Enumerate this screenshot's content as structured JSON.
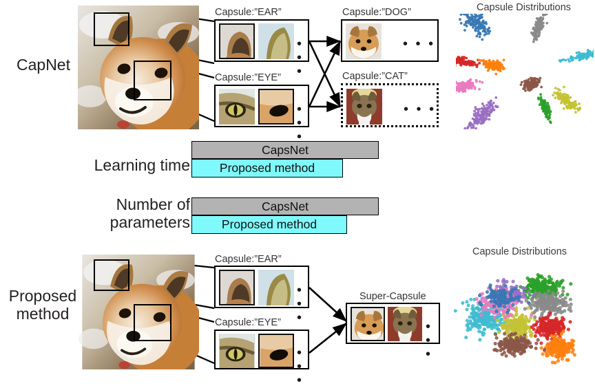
{
  "figure": {
    "rows": [
      {
        "id": "capnet",
        "label": "CapNet"
      },
      {
        "id": "proposed",
        "label": "Proposed\nmethod"
      }
    ]
  },
  "top_row": {
    "row_label": "CapNet",
    "part_capsules": [
      {
        "name": "capsule-ear",
        "label": "Capsule:”EAR”",
        "ellipsis": "• • •",
        "thumbs": [
          "dog-ear-thumb",
          "cat-ear-thumb"
        ]
      },
      {
        "name": "capsule-eye",
        "label": "Capsule:”EYE”",
        "ellipsis": "• • •",
        "thumbs": [
          "cat-eye-thumb",
          "dog-eye-thumb"
        ]
      }
    ],
    "class_capsules": [
      {
        "name": "capsule-dog",
        "label": "Capsule:”DOG”",
        "ellipsis": "• • •",
        "border": "solid",
        "thumbs": [
          "dog-face-thumb"
        ]
      },
      {
        "name": "capsule-cat",
        "label": "Capsule:”CAT”",
        "ellipsis": "• • •",
        "border": "dotted",
        "thumbs": [
          "cat-face-thumb"
        ]
      }
    ],
    "scatter_title": "Capsule Distributions"
  },
  "bottom_row": {
    "row_label": "Proposed\nmethod",
    "part_capsules": [
      {
        "name": "capsule-ear",
        "label": "Capsule:”EAR”",
        "ellipsis": "• • •",
        "thumbs": [
          "dog-ear-thumb",
          "cat-ear-thumb"
        ]
      },
      {
        "name": "capsule-eye",
        "label": "Capsule:”EYE”",
        "ellipsis": "• • •",
        "thumbs": [
          "cat-eye-thumb",
          "dog-eye-thumb"
        ]
      }
    ],
    "super_capsule": {
      "name": "super-capsule",
      "label": "Super-Capsule",
      "ellipsis": "• • •",
      "thumbs": [
        "dog-face-thumb",
        "cat-face-thumb"
      ]
    },
    "scatter_title": "Capsule Distributions"
  },
  "chart_data": {
    "type": "bar",
    "title": "",
    "orientation": "horizontal",
    "categories": [
      "Learning time",
      "Number of\nparameters"
    ],
    "series": [
      {
        "name": "CapsNet",
        "label": "CapsNet",
        "color": "#b3b3b3",
        "values": [
          100,
          100
        ]
      },
      {
        "name": "Proposed method",
        "label": "Proposed method",
        "color": "#7ff9fb",
        "values": [
          81,
          83
        ]
      }
    ],
    "value_unit": "relative (CapsNet = 100)",
    "xlabel": "",
    "ylabel": "",
    "grid": false,
    "legend": "none (labels drawn inside bars)"
  },
  "colors": {
    "capsnet_bar": "#b3b3b3",
    "proposed_bar": "#7ff9fb",
    "outline": "#000000",
    "text": "#231f20",
    "caption": "#3a3a3a"
  },
  "scatter_top": {
    "type": "scatter",
    "title": "Capsule Distributions",
    "description": "ten elongated radial capsule clusters spreading out from a shared center",
    "clusters": [
      {
        "label": "class-0",
        "color": "#3878b4",
        "cx": -0.52,
        "cy": -0.62,
        "angle": -128,
        "len": 0.4,
        "wid": 0.13,
        "n": 150
      },
      {
        "label": "class-1",
        "color": "#8a8a8a",
        "cx": 0.13,
        "cy": -0.5,
        "angle": -75,
        "len": 0.38,
        "wid": 0.055,
        "n": 130
      },
      {
        "label": "class-2",
        "color": "#3fbcd2",
        "cx": 0.58,
        "cy": -0.18,
        "angle": -18,
        "len": 0.5,
        "wid": 0.055,
        "n": 150
      },
      {
        "label": "class-3",
        "color": "#c4c335",
        "cx": 0.4,
        "cy": 0.32,
        "angle": 42,
        "len": 0.36,
        "wid": 0.075,
        "n": 130
      },
      {
        "label": "class-4",
        "color": "#2aa02a",
        "cx": 0.22,
        "cy": 0.44,
        "angle": 68,
        "len": 0.3,
        "wid": 0.045,
        "n": 110
      },
      {
        "label": "class-5",
        "color": "#8c5648",
        "cx": 0.05,
        "cy": 0.12,
        "angle": 60,
        "len": 0.14,
        "wid": 0.11,
        "n": 130
      },
      {
        "label": "class-6",
        "color": "#9a6fc4",
        "cx": -0.42,
        "cy": 0.5,
        "angle": 128,
        "len": 0.42,
        "wid": 0.095,
        "n": 160
      },
      {
        "label": "class-7",
        "color": "#e87bbf",
        "cx": -0.62,
        "cy": 0.18,
        "angle": 164,
        "len": 0.4,
        "wid": 0.085,
        "n": 150
      },
      {
        "label": "class-8",
        "color": "#d62728",
        "cx": -0.66,
        "cy": -0.14,
        "angle": 188,
        "len": 0.42,
        "wid": 0.065,
        "n": 140
      },
      {
        "label": "class-9",
        "color": "#ff7f0e",
        "cx": -0.28,
        "cy": -0.05,
        "angle": 198,
        "len": 0.24,
        "wid": 0.065,
        "n": 120
      }
    ]
  },
  "scatter_bottom": {
    "type": "scatter",
    "title": "Capsule Distributions",
    "description": "ten compact overlapping isotropic capsule clusters packed together",
    "clusters": [
      {
        "label": "class-0",
        "color": "#3fbcd2",
        "cx": -0.52,
        "cy": 0.06,
        "rx": 0.27,
        "ry": 0.3,
        "n": 220
      },
      {
        "label": "class-1",
        "color": "#c4c335",
        "cx": -0.1,
        "cy": 0.18,
        "rx": 0.22,
        "ry": 0.24,
        "n": 190
      },
      {
        "label": "class-2",
        "color": "#2aa02a",
        "cx": 0.26,
        "cy": -0.5,
        "rx": 0.26,
        "ry": 0.2,
        "n": 210
      },
      {
        "label": "class-3",
        "color": "#8a8a8a",
        "cx": 0.36,
        "cy": -0.2,
        "rx": 0.25,
        "ry": 0.22,
        "n": 200
      },
      {
        "label": "class-4",
        "color": "#d62728",
        "cx": 0.38,
        "cy": 0.22,
        "rx": 0.2,
        "ry": 0.21,
        "n": 190
      },
      {
        "label": "class-5",
        "color": "#ff7f0e",
        "cx": 0.5,
        "cy": 0.6,
        "rx": 0.19,
        "ry": 0.2,
        "n": 180
      },
      {
        "label": "class-6",
        "color": "#8c5648",
        "cx": -0.12,
        "cy": 0.56,
        "rx": 0.24,
        "ry": 0.18,
        "n": 190
      },
      {
        "label": "class-7",
        "color": "#9a6fc4",
        "cx": -0.2,
        "cy": -0.38,
        "rx": 0.24,
        "ry": 0.22,
        "n": 150
      },
      {
        "label": "class-8",
        "color": "#e87bbf",
        "cx": -0.34,
        "cy": -0.22,
        "rx": 0.26,
        "ry": 0.26,
        "n": 130
      },
      {
        "label": "class-9",
        "color": "#3878b4",
        "cx": -0.28,
        "cy": -0.32,
        "rx": 0.22,
        "ry": 0.2,
        "n": 110
      }
    ]
  }
}
